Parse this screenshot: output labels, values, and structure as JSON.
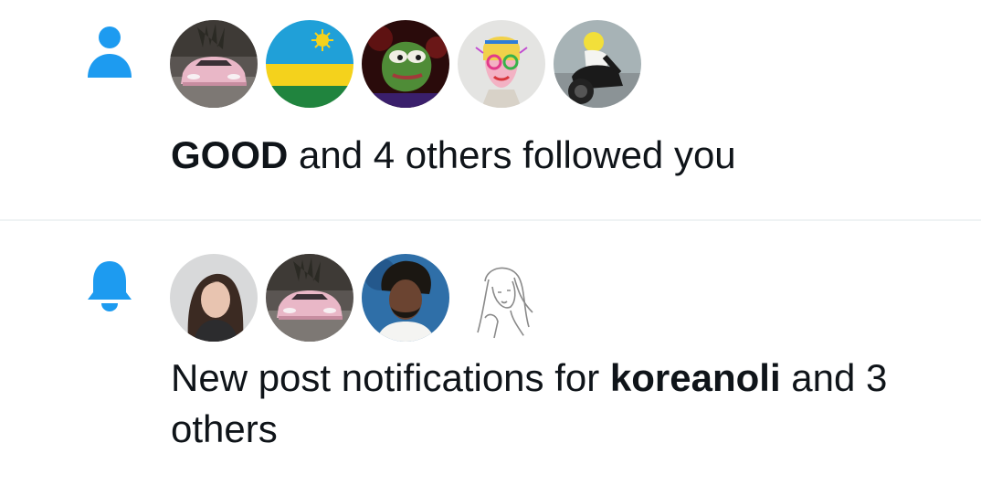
{
  "colors": {
    "accent": "#1d9bf0",
    "text": "#0f1419",
    "divider": "#eff3f4"
  },
  "notifications": [
    {
      "type": "follow",
      "icon": "person-icon",
      "avatars": [
        "pink-car-avatar",
        "rwanda-flag-avatar",
        "pepe-frog-avatar",
        "colorful-art-avatar",
        "motorcycle-rider-avatar"
      ],
      "actor": "GOOD",
      "rest": " and 4 others followed you"
    },
    {
      "type": "new-post",
      "icon": "bell-icon",
      "avatars": [
        "woman-avatar",
        "pink-car-avatar",
        "man-avatar",
        "sketch-drawing-avatar"
      ],
      "prefix": "New post notifications for ",
      "actor": "koreanoli",
      "rest": " and 3 others"
    }
  ]
}
